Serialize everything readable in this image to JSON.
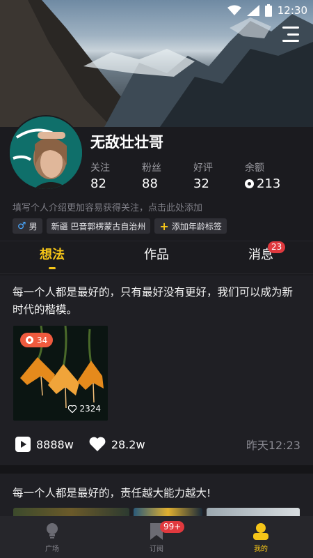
{
  "status": {
    "time": "12:30"
  },
  "profile": {
    "username": "无敌壮壮哥",
    "stats": [
      {
        "label": "关注",
        "value": "82"
      },
      {
        "label": "粉丝",
        "value": "88"
      },
      {
        "label": "好评",
        "value": "32"
      },
      {
        "label": "余额",
        "value": "213"
      }
    ],
    "intro_placeholder": "填写个人介绍更加容易获得关注，点击此处添加",
    "tags": {
      "gender": "男",
      "location": "新疆 巴音郭楞蒙古自治州",
      "add_age": "添加年龄标签"
    }
  },
  "tabs": [
    {
      "label": "想法"
    },
    {
      "label": "作品"
    },
    {
      "label": "消息",
      "badge": "23"
    }
  ],
  "post1": {
    "text": "每一个人都是最好的，只有最好没有更好，我们可以成为新时代的楷模。",
    "image_coins": "34",
    "image_likes": "2324",
    "plays": "8888w",
    "likes": "28.2w",
    "time": "昨天12:23"
  },
  "post2": {
    "text": "每一个人都是最好的，责任越大能力越大!"
  },
  "bottom_nav": [
    {
      "label": "广场"
    },
    {
      "label": "订阅",
      "badge": "99+"
    },
    {
      "label": "我的"
    }
  ],
  "colors": {
    "accent": "#f5c518",
    "badge": "#e0393e",
    "background": "#1b1b1f"
  },
  "icons": [
    "wifi-icon",
    "signal-icon",
    "battery-icon",
    "menu-icon",
    "male-icon",
    "plus-icon",
    "coin-icon",
    "play-icon",
    "heart-icon",
    "bulb-icon",
    "bookmark-icon",
    "user-icon"
  ]
}
